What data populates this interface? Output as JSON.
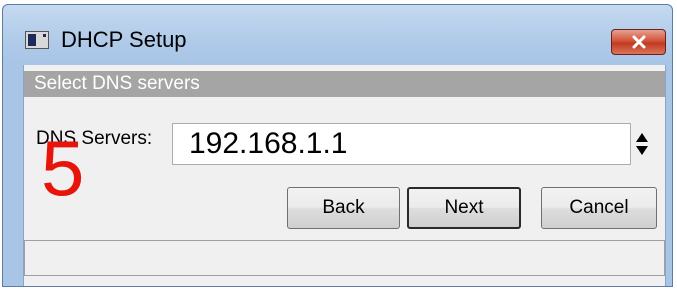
{
  "window": {
    "title": "DHCP Setup",
    "icon": "app-window-icon",
    "close_icon": "close-icon"
  },
  "section": {
    "header": "Select DNS servers"
  },
  "dns": {
    "label": "DNS Servers:",
    "value": "192.168.1.1",
    "spinner_icon": "up-down-arrows-icon"
  },
  "buttons": {
    "back": "Back",
    "next": "Next",
    "cancel": "Cancel"
  },
  "annotation": {
    "step": "5",
    "color": "#e8140c"
  },
  "colors": {
    "header_bg": "#a5a5a5",
    "close_button": "#c23a20",
    "titlebar": "#b9d1ec"
  }
}
